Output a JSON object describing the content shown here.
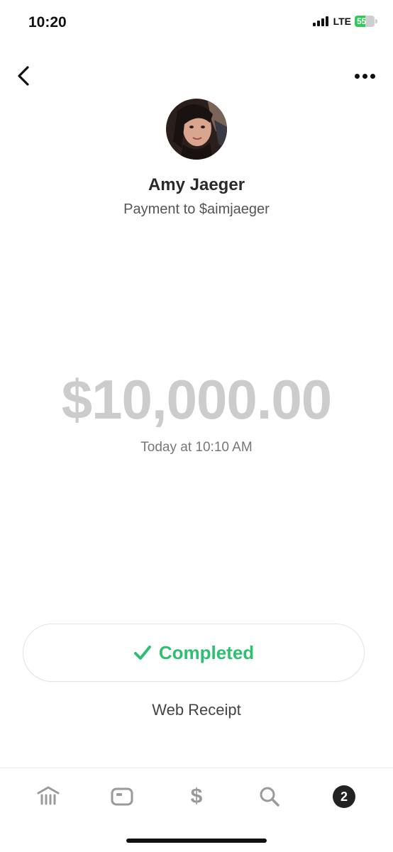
{
  "status_bar": {
    "time": "10:20",
    "network": "LTE",
    "battery_percent": "55",
    "battery_level": 0.55,
    "battery_color": "#34c759"
  },
  "nav": {
    "back_icon": "chevron-left-icon",
    "more_icon": "ellipsis-icon"
  },
  "profile": {
    "name": "Amy Jaeger",
    "subtitle": "Payment to $aimjaeger"
  },
  "payment": {
    "amount": "$10,000.00",
    "timestamp": "Today at 10:10 AM"
  },
  "status": {
    "label": "Completed",
    "icon": "checkmark-icon",
    "color": "#2fbf71"
  },
  "links": {
    "web_receipt": "Web Receipt"
  },
  "tab_bar": {
    "tabs": [
      {
        "name": "banking",
        "icon": "bank-icon"
      },
      {
        "name": "card",
        "icon": "card-icon"
      },
      {
        "name": "pay",
        "icon": "dollar-sign-icon",
        "glyph": "$"
      },
      {
        "name": "search",
        "icon": "search-icon"
      },
      {
        "name": "activity",
        "icon": "activity-badge-icon",
        "badge": "2"
      }
    ]
  }
}
